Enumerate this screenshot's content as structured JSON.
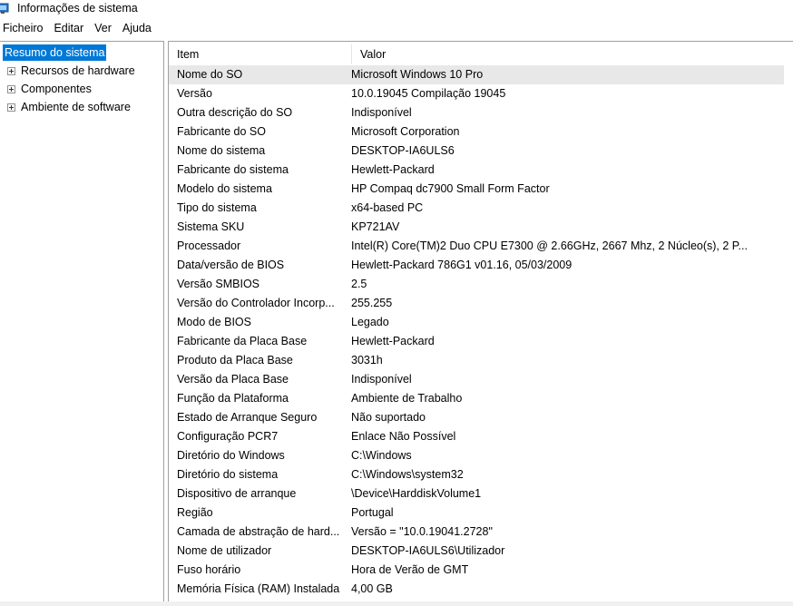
{
  "window": {
    "title": "Informações de sistema"
  },
  "menu": [
    "Ficheiro",
    "Editar",
    "Ver",
    "Ajuda"
  ],
  "tree": {
    "selected": "Resumo do sistema",
    "children": [
      "Recursos de hardware",
      "Componentes",
      "Ambiente de software"
    ]
  },
  "list": {
    "columns": {
      "item": "Item",
      "value": "Valor"
    },
    "rows": [
      {
        "item": "Nome do SO",
        "value": "Microsoft Windows 10 Pro"
      },
      {
        "item": "Versão",
        "value": "10.0.19045 Compilação 19045"
      },
      {
        "item": "Outra descrição do SO",
        "value": "Indisponível"
      },
      {
        "item": "Fabricante do SO",
        "value": "Microsoft Corporation"
      },
      {
        "item": "Nome do sistema",
        "value": "DESKTOP-IA6ULS6"
      },
      {
        "item": "Fabricante do sistema",
        "value": "Hewlett-Packard"
      },
      {
        "item": "Modelo do sistema",
        "value": "HP Compaq dc7900 Small Form Factor"
      },
      {
        "item": "Tipo do sistema",
        "value": "x64-based PC"
      },
      {
        "item": "Sistema SKU",
        "value": "KP721AV"
      },
      {
        "item": "Processador",
        "value": "Intel(R) Core(TM)2 Duo CPU     E7300  @ 2.66GHz, 2667 Mhz, 2 Núcleo(s), 2 P..."
      },
      {
        "item": "Data/versão de BIOS",
        "value": "Hewlett-Packard 786G1 v01.16, 05/03/2009"
      },
      {
        "item": "Versão SMBIOS",
        "value": "2.5"
      },
      {
        "item": "Versão do Controlador Incorp...",
        "value": "255.255"
      },
      {
        "item": "Modo de BIOS",
        "value": "Legado"
      },
      {
        "item": "Fabricante da Placa Base",
        "value": "Hewlett-Packard"
      },
      {
        "item": "Produto da Placa Base",
        "value": "3031h"
      },
      {
        "item": "Versão da Placa Base",
        "value": "Indisponível"
      },
      {
        "item": "Função da Plataforma",
        "value": "Ambiente de Trabalho"
      },
      {
        "item": "Estado de Arranque Seguro",
        "value": "Não suportado"
      },
      {
        "item": "Configuração PCR7",
        "value": "Enlace Não Possível"
      },
      {
        "item": "Diretório do Windows",
        "value": "C:\\Windows"
      },
      {
        "item": "Diretório do sistema",
        "value": "C:\\Windows\\system32"
      },
      {
        "item": "Dispositivo de arranque",
        "value": "\\Device\\HarddiskVolume1"
      },
      {
        "item": "Região",
        "value": "Portugal"
      },
      {
        "item": "Camada de abstração de hard...",
        "value": "Versão = \"10.0.19041.2728\""
      },
      {
        "item": "Nome de utilizador",
        "value": "DESKTOP-IA6ULS6\\Utilizador"
      },
      {
        "item": "Fuso horário",
        "value": "Hora de Verão de GMT"
      },
      {
        "item": "Memória Física (RAM) Instalada",
        "value": "4,00 GB"
      }
    ]
  },
  "colors": {
    "selection": "#0078d7",
    "highlight_row": "#e8e8e8",
    "border": "#a0a0a0"
  },
  "icons": {
    "app": "system-information-icon",
    "expander": "plus-box-icon"
  }
}
